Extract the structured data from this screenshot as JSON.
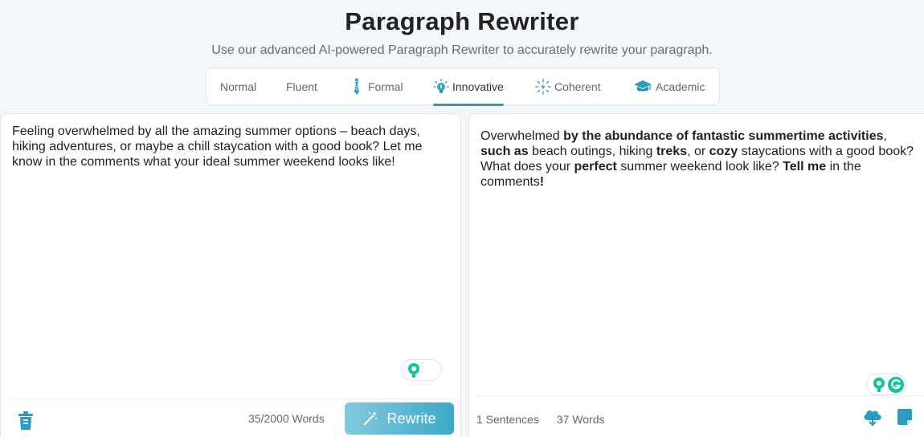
{
  "header": {
    "title": "Paragraph Rewriter",
    "subtitle": "Use our advanced AI-powered Paragraph Rewriter to accurately rewrite your paragraph."
  },
  "tabs": [
    {
      "label": "Normal",
      "icon": "none",
      "active": false
    },
    {
      "label": "Fluent",
      "icon": "none",
      "active": false
    },
    {
      "label": "Formal",
      "icon": "tie-icon",
      "active": false
    },
    {
      "label": "Innovative",
      "icon": "lightbulb-icon",
      "active": true
    },
    {
      "label": "Coherent",
      "icon": "sparkle-icon",
      "active": false
    },
    {
      "label": "Academic",
      "icon": "graduation-cap-icon",
      "active": false
    }
  ],
  "input": {
    "text": "Feeling overwhelmed by all the amazing summer options – beach days, hiking adventures, or maybe a chill staycation with a good book? Let me know in the comments what your ideal summer weekend looks like!",
    "word_count": "35/2000 Words",
    "rewrite_label": "Rewrite"
  },
  "output": {
    "segments": [
      {
        "text": "Overwhelmed ",
        "bold": false
      },
      {
        "text": "by the abundance of fantastic summertime activities",
        "bold": true
      },
      {
        "text": ", ",
        "bold": false
      },
      {
        "text": "such as",
        "bold": true
      },
      {
        "text": " beach outings, hiking ",
        "bold": false
      },
      {
        "text": "treks",
        "bold": true
      },
      {
        "text": ", or ",
        "bold": false
      },
      {
        "text": "cozy",
        "bold": true
      },
      {
        "text": " staycations with a good book? What does your ",
        "bold": false
      },
      {
        "text": "perfect",
        "bold": true
      },
      {
        "text": " summer weekend look like? ",
        "bold": false
      },
      {
        "text": "Tell me",
        "bold": true
      },
      {
        "text": " in the comments",
        "bold": false
      },
      {
        "text": "!",
        "bold": true
      }
    ],
    "sentences": "1 Sentences",
    "words": "37 Words"
  },
  "colors": {
    "accent": "#2e9bc0",
    "grammarly_green": "#15c39a",
    "button_gradient_start": "#82c9de",
    "button_gradient_end": "#3ea8c8"
  }
}
